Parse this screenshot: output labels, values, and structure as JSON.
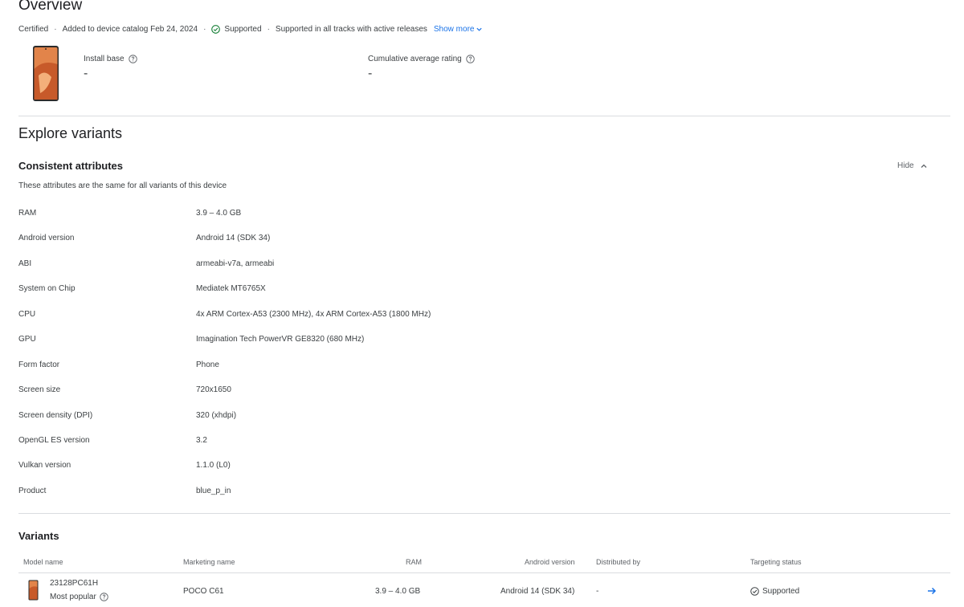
{
  "overview": {
    "title": "Overview",
    "certified": "Certified",
    "added": "Added to device catalog Feb 24, 2024",
    "supported": "Supported",
    "supported_detail": "Supported in all tracks with active releases",
    "show_more": "Show more",
    "install_base": {
      "label": "Install base",
      "value": "-"
    },
    "rating": {
      "label": "Cumulative average rating",
      "value": "-"
    }
  },
  "explore": {
    "title": "Explore variants",
    "consistent_title": "Consistent attributes",
    "consistent_desc": "These attributes are the same for all variants of this device",
    "hide_label": "Hide",
    "attributes": [
      {
        "k": "RAM",
        "v": "3.9 – 4.0 GB"
      },
      {
        "k": "Android version",
        "v": "Android 14 (SDK 34)"
      },
      {
        "k": "ABI",
        "v": "armeabi-v7a, armeabi"
      },
      {
        "k": "System on Chip",
        "v": "Mediatek MT6765X"
      },
      {
        "k": "CPU",
        "v": "4x ARM Cortex-A53 (2300 MHz), 4x ARM Cortex-A53 (1800 MHz)"
      },
      {
        "k": "GPU",
        "v": "Imagination Tech PowerVR GE8320 (680 MHz)"
      },
      {
        "k": "Form factor",
        "v": "Phone"
      },
      {
        "k": "Screen size",
        "v": "720x1650"
      },
      {
        "k": "Screen density (DPI)",
        "v": "320 (xhdpi)"
      },
      {
        "k": "OpenGL ES version",
        "v": "3.2"
      },
      {
        "k": "Vulkan version",
        "v": "1.1.0 (L0)"
      },
      {
        "k": "Product",
        "v": "blue_p_in"
      }
    ]
  },
  "variants": {
    "title": "Variants",
    "headers": {
      "model": "Model name",
      "marketing": "Marketing name",
      "ram": "RAM",
      "android": "Android version",
      "distributed": "Distributed by",
      "targeting": "Targeting status"
    },
    "rows": [
      {
        "model": "23128PC61H",
        "popular": "Most popular",
        "marketing": "POCO C61",
        "ram": "3.9 – 4.0 GB",
        "android": "Android 14 (SDK 34)",
        "distributed": "-",
        "targeting": "Supported"
      }
    ]
  },
  "colors": {
    "accent": "#1a73e8",
    "success": "#188038",
    "divider": "#dadce0"
  },
  "icons": [
    "check-circle-icon",
    "chevron-down-icon",
    "help-icon",
    "chevron-up-icon",
    "arrow-right-icon"
  ]
}
